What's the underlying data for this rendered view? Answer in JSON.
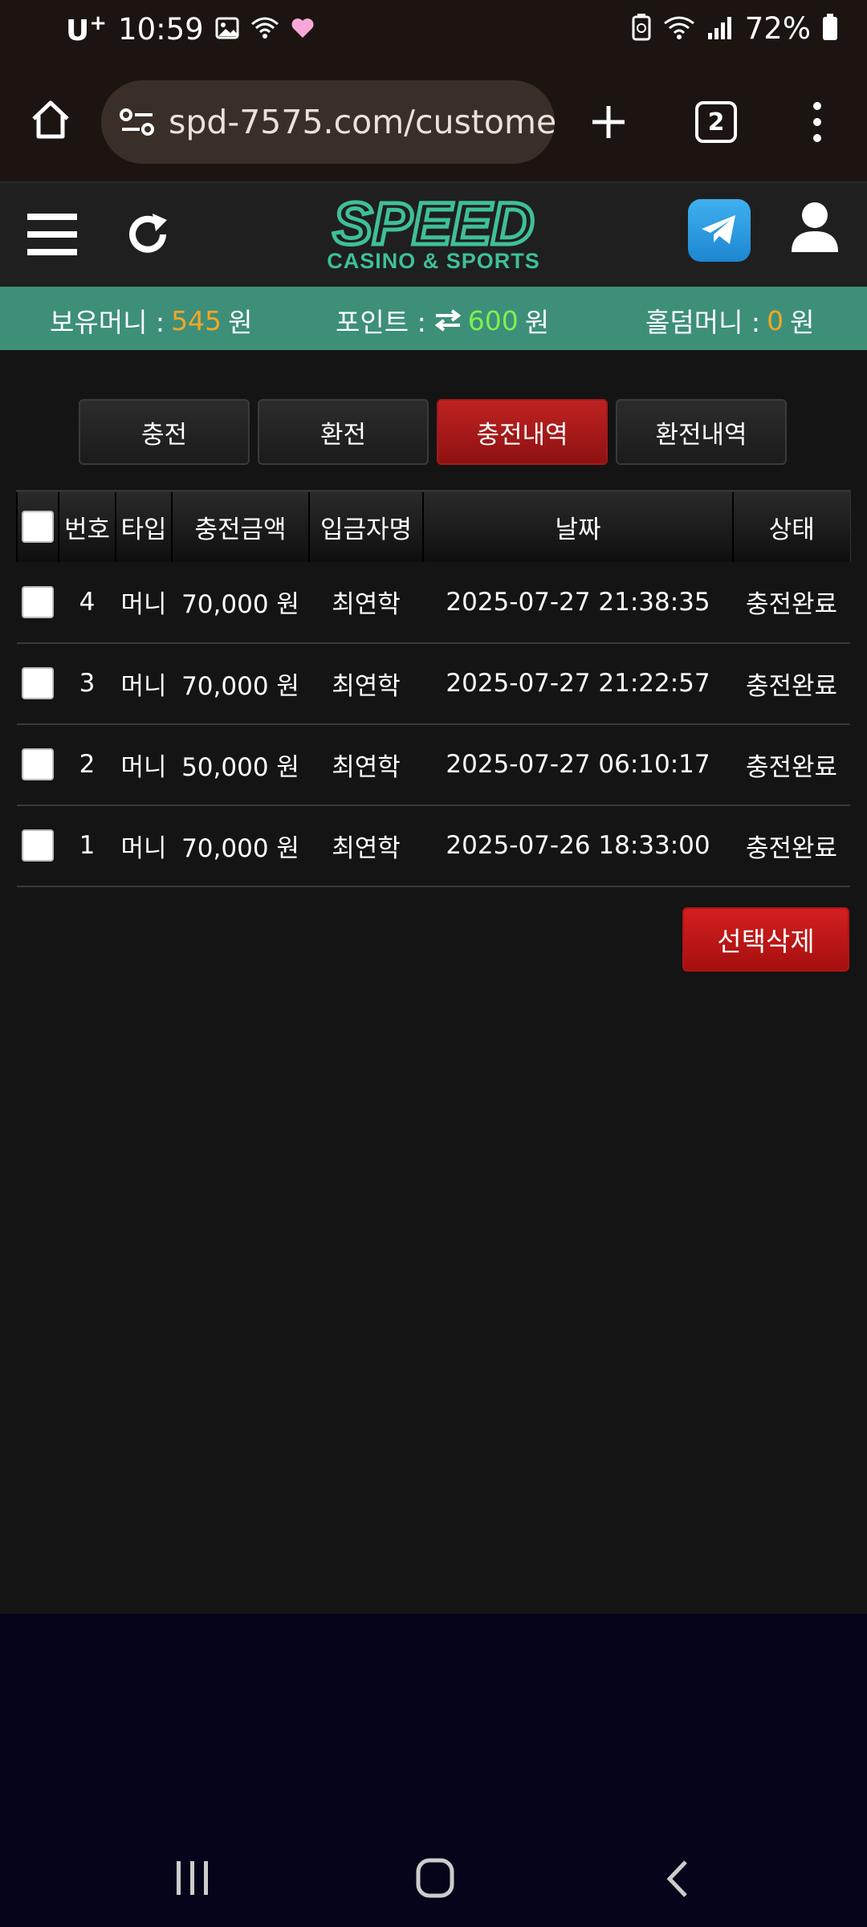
{
  "status_bar": {
    "carrier": "U",
    "carrier_sup": "+",
    "time": "10:59",
    "battery": "72%"
  },
  "browser": {
    "url": "spd-7575.com/custome",
    "tab_count": "2"
  },
  "header": {
    "logo_main": "SPEED",
    "logo_sub": "CASINO & SPORTS"
  },
  "balance": {
    "money_label": "보유머니 :",
    "money_value": "545",
    "money_unit": "원",
    "points_label": "포인트 :",
    "points_value": "600",
    "points_unit": "원",
    "holdem_label": "홀덤머니 :",
    "holdem_value": "0",
    "holdem_unit": "원"
  },
  "tabs": [
    {
      "label": "충전",
      "active": false
    },
    {
      "label": "환전",
      "active": false
    },
    {
      "label": "충전내역",
      "active": true
    },
    {
      "label": "환전내역",
      "active": false
    }
  ],
  "table": {
    "headers": [
      "번호",
      "타입",
      "충전금액",
      "입금자명",
      "날짜",
      "상태"
    ],
    "rows": [
      {
        "no": "4",
        "type": "머니",
        "amount": "70,000 원",
        "depositor": "최연학",
        "date": "2025-07-27 21:38:35",
        "status": "충전완료"
      },
      {
        "no": "3",
        "type": "머니",
        "amount": "70,000 원",
        "depositor": "최연학",
        "date": "2025-07-27 21:22:57",
        "status": "충전완료"
      },
      {
        "no": "2",
        "type": "머니",
        "amount": "50,000 원",
        "depositor": "최연학",
        "date": "2025-07-27 06:10:17",
        "status": "충전완료"
      },
      {
        "no": "1",
        "type": "머니",
        "amount": "70,000 원",
        "depositor": "최연학",
        "date": "2025-07-26 18:33:00",
        "status": "충전완료"
      }
    ]
  },
  "delete_button": "선택삭제",
  "colors": {
    "accent_green": "#3d8f7a",
    "logo_green": "#3fbf99",
    "active_red": "#c02222",
    "orange_value": "#f5a623",
    "green_value": "#7cf24f"
  }
}
